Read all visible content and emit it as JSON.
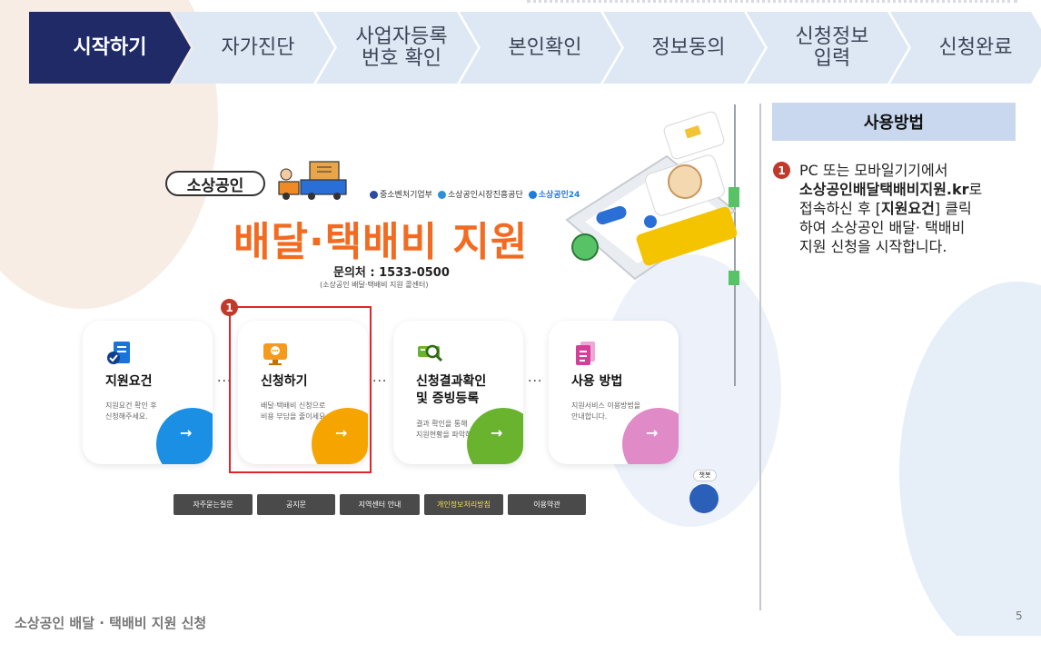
{
  "steps": [
    {
      "label": "시작하기",
      "active": true
    },
    {
      "label": "자가진단",
      "active": false
    },
    {
      "label": "사업자등록\n번호 확인",
      "active": false
    },
    {
      "label": "본인확인",
      "active": false
    },
    {
      "label": "정보동의",
      "active": false
    },
    {
      "label": "신청정보\n입력",
      "active": false
    },
    {
      "label": "신청완료",
      "active": false
    }
  ],
  "screenshot": {
    "logo": "소상공인",
    "orgs": [
      "중소벤처기업부",
      "소상공인시장진흥공단",
      "소상공인24"
    ],
    "headline": "배달·택배비 지원",
    "contact": "문의처 : 1533-0500",
    "contact_sub": "(소상공인 배달·택배비 지원 콜센터)",
    "cards": [
      {
        "title": "지원요건",
        "desc": "지원요건 확인 후\n신청해주세요.",
        "color": "#1a8fe3"
      },
      {
        "title": "신청하기",
        "desc": "배달·택배비 신청으로\n비용 부담을 줄이세요.",
        "color": "#f5a400"
      },
      {
        "title": "신청결과확인\n및 증빙등록",
        "desc": "결과 확인을 통해\n지원현황을 파악하세요.",
        "color": "#6ab32e"
      },
      {
        "title": "사용 방법",
        "desc": "지원서비스 이용방법을\n안내합니다.",
        "color": "#e08ac8"
      }
    ],
    "badge": "1",
    "bottom_buttons": [
      "자주묻는질문",
      "공지문",
      "지역센터 안내",
      "개인정보처리방침",
      "이용약관"
    ],
    "chatbot_label": "챗봇"
  },
  "usage": {
    "heading": "사용방법",
    "step_num": "1",
    "text_line1": "PC 또는 모바일기기에서",
    "url": "소상공인배달택배비지원.kr",
    "text_ro": "로",
    "text_line3a": "접속하신 후 [",
    "link_label": "지원요건",
    "text_line3b": "] 클릭",
    "text_line4": "하여 소상공인 배달· 택배비",
    "text_line5": "지원 신청을 시작합니다."
  },
  "footer": {
    "title": "소상공인 배달 · 택배비 지원 신청",
    "page": "5"
  }
}
